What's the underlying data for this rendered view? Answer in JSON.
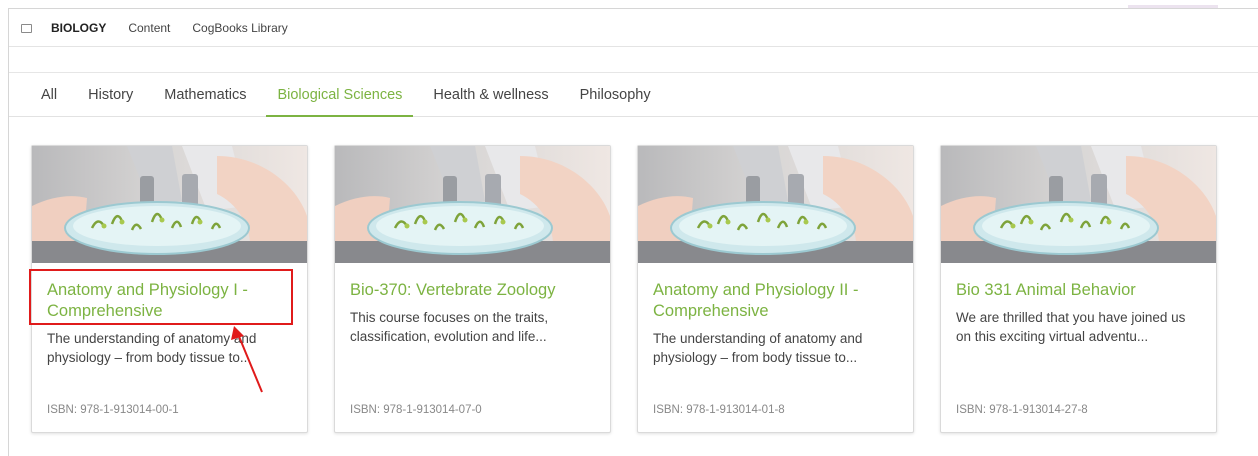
{
  "breadcrumb": {
    "icon": "book-icon",
    "items": [
      "BIOLOGY",
      "Content",
      "CogBooks Library"
    ]
  },
  "tabs": [
    {
      "label": "All"
    },
    {
      "label": "History"
    },
    {
      "label": "Mathematics"
    },
    {
      "label": "Biological Sciences",
      "active": true
    },
    {
      "label": "Health & wellness"
    },
    {
      "label": "Philosophy"
    }
  ],
  "accent_color": "#7cb342",
  "annotation_color": "#e01b1b",
  "cards": [
    {
      "title": "Anatomy and Physiology I - Comprehensive",
      "description": "The understanding of anatomy and physiology – from body tissue to...",
      "isbn": "ISBN: 978-1-913014-00-1"
    },
    {
      "title": "Bio-370: Vertebrate Zoology",
      "description": "This course focuses on the traits, classification, evolution and life...",
      "isbn": "ISBN: 978-1-913014-07-0"
    },
    {
      "title": "Anatomy and Physiology II - Comprehensive",
      "description": "The understanding of anatomy and physiology – from body tissue to...",
      "isbn": "ISBN: 978-1-913014-01-8"
    },
    {
      "title": "Bio 331 Animal Behavior",
      "description": "We are thrilled that you have joined us on this exciting virtual adventu...",
      "isbn": "ISBN: 978-1-913014-27-8"
    }
  ]
}
